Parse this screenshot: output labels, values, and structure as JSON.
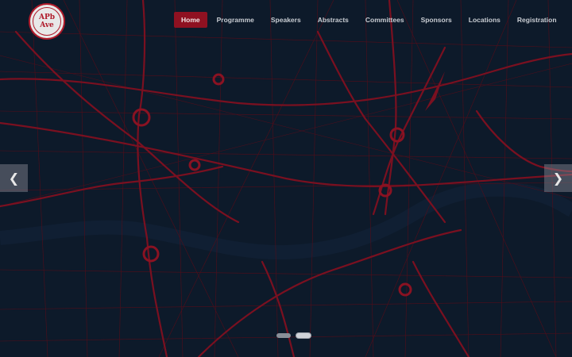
{
  "logo": {
    "line1": "APb",
    "line2": "Ave"
  },
  "nav": {
    "items": [
      "Home",
      "Programme",
      "Speakers",
      "Abstracts",
      "Committees",
      "Sponsors",
      "Locations",
      "Registration"
    ],
    "active": "Home"
  },
  "carousel": {
    "slides": 2,
    "active_slide": 2
  },
  "colors": {
    "accent": "#8f1121",
    "background": "#0d1a2a",
    "map_roads": "#6e0f1c"
  },
  "icons": {
    "prev": "chevron-left-icon",
    "next": "chevron-right-icon"
  }
}
